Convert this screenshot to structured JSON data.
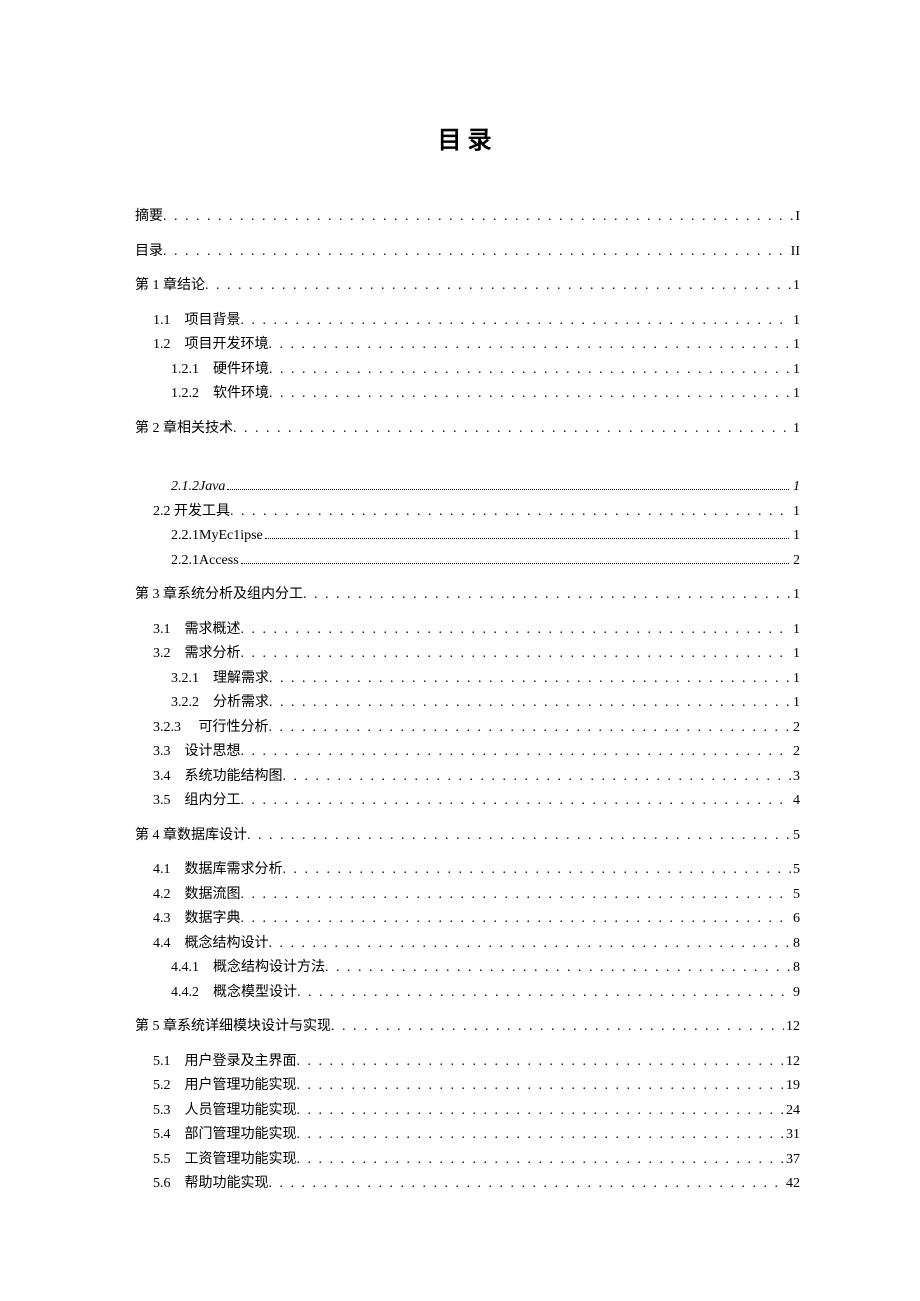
{
  "title": "目录",
  "entries": [
    {
      "label": "摘要 ",
      "page": "I",
      "indent": 0,
      "style": "sparse",
      "gap": "top"
    },
    {
      "label": "目录",
      "page": "II",
      "indent": 0,
      "style": "sparse",
      "gap": "top"
    },
    {
      "label": "第 1 章结论 ",
      "page": "1",
      "indent": 0,
      "style": "sparse",
      "gap": "top"
    },
    {
      "label": "1.1　项目背景",
      "page": "1",
      "indent": 1,
      "style": "sparse",
      "gap": "top"
    },
    {
      "label": "1.2　项目开发环境",
      "page": "1",
      "indent": 1,
      "style": "sparse"
    },
    {
      "label": "1.2.1　硬件环境",
      "page": "1",
      "indent": 2,
      "style": "sparse"
    },
    {
      "label": "1.2.2　软件环境",
      "page": "1",
      "indent": 2,
      "style": "sparse"
    },
    {
      "label": "第 2 章相关技术 ",
      "page": "1",
      "indent": 0,
      "style": "sparse",
      "gap": "top"
    },
    {
      "label": "2.1.2Java ",
      "page": "1",
      "indent": 2,
      "style": "dense",
      "italic": true,
      "gap": "top-large"
    },
    {
      "label": "2.2 开发工具 ",
      "page": "1",
      "indent": 1,
      "style": "sparse"
    },
    {
      "label": "2.2.1MyEc1ipse ",
      "page": "1",
      "indent": 2,
      "style": "dense"
    },
    {
      "label": "2.2.1Access ",
      "page": "2",
      "indent": 2,
      "style": "dense"
    },
    {
      "label": "第 3 章系统分析及组内分工 ",
      "page": "1",
      "indent": 0,
      "style": "sparse",
      "gap": "top"
    },
    {
      "label": "3.1　需求概述 ",
      "page": "1",
      "indent": 1,
      "style": "sparse",
      "gap": "top"
    },
    {
      "label": "3.2　需求分析 ",
      "page": "1",
      "indent": 1,
      "style": "sparse"
    },
    {
      "label": "3.2.1　理解需求",
      "page": "1",
      "indent": 2,
      "style": "sparse"
    },
    {
      "label": "3.2.2　分析需求 ",
      "page": "1",
      "indent": 2,
      "style": "sparse"
    },
    {
      "label": "3.2.3　 可行性分析",
      "page": "2",
      "indent": 1,
      "style": "sparse"
    },
    {
      "label": "3.3　设计思想 ",
      "page": "2",
      "indent": 1,
      "style": "sparse"
    },
    {
      "label": "3.4　系统功能结构图 ",
      "page": "3",
      "indent": 1,
      "style": "sparse"
    },
    {
      "label": "3.5　组内分工 ",
      "page": "4",
      "indent": 1,
      "style": "sparse"
    },
    {
      "label": "第 4 章数据库设计 ",
      "page": "5",
      "indent": 0,
      "style": "sparse",
      "gap": "top"
    },
    {
      "label": "4.1　数据库需求分析 ",
      "page": "5",
      "indent": 1,
      "style": "sparse",
      "gap": "top"
    },
    {
      "label": "4.2　数据流图 ",
      "page": "5",
      "indent": 1,
      "style": "sparse"
    },
    {
      "label": "4.3　数据字典 ",
      "page": "6",
      "indent": 1,
      "style": "sparse"
    },
    {
      "label": "4.4　概念结构设计 ",
      "page": "8",
      "indent": 1,
      "style": "sparse"
    },
    {
      "label": "4.4.1　概念结构设计方法",
      "page": "8",
      "indent": 2,
      "style": "sparse"
    },
    {
      "label": "4.4.2　概念模型设计 ",
      "page": "9",
      "indent": 2,
      "style": "sparse"
    },
    {
      "label": "第 5 章系统详细模块设计与实现 ",
      "page": "12",
      "indent": 0,
      "style": "sparse",
      "gap": "top"
    },
    {
      "label": "5.1　用户登录及主界面 ",
      "page": "12",
      "indent": 1,
      "style": "sparse",
      "gap": "top"
    },
    {
      "label": "5.2　用户管理功能实现 ",
      "page": "19",
      "indent": 1,
      "style": "sparse"
    },
    {
      "label": "5.3　人员管理功能实现 ",
      "page": "24",
      "indent": 1,
      "style": "sparse"
    },
    {
      "label": "5.4　部门管理功能实现 ",
      "page": "31",
      "indent": 1,
      "style": "sparse"
    },
    {
      "label": "5.5　工资管理功能实现 ",
      "page": "37",
      "indent": 1,
      "style": "sparse"
    },
    {
      "label": "5.6　帮助功能实现 ",
      "page": "42",
      "indent": 1,
      "style": "sparse"
    }
  ]
}
